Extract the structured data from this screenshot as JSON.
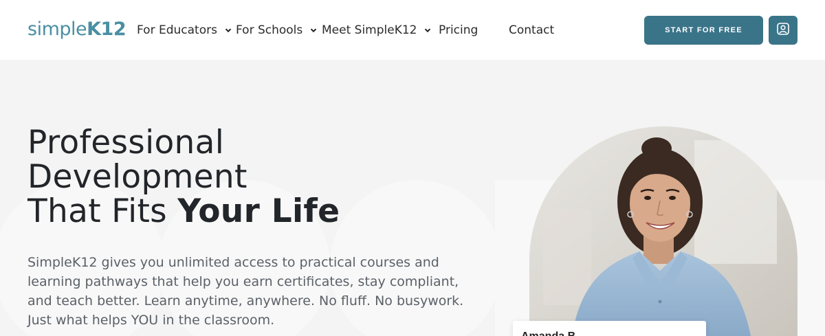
{
  "brand": {
    "logo_simple": "simple",
    "logo_k12": "K12",
    "accent_color": "#3a7489",
    "logo_color": "#4a8fa3"
  },
  "nav": {
    "items": [
      {
        "label": "For Educators",
        "dropdown": true
      },
      {
        "label": "For Schools",
        "dropdown": true
      },
      {
        "label": "Meet SimpleK12",
        "dropdown": true
      },
      {
        "label": "Pricing",
        "dropdown": false
      },
      {
        "label": "Contact",
        "dropdown": false
      }
    ],
    "cta_label": "START FOR FREE",
    "account_icon": "user-account-icon"
  },
  "hero": {
    "headline_line1": "Professional",
    "headline_line2": "Development",
    "headline_line3_regular": "That Fits ",
    "headline_line3_bold": "Your Life",
    "intro": "SimpleK12 gives you unlimited access to practical courses and learning pathways that help you earn certificates, stay compliant, and teach better. Learn anytime, anywhere. No fluff. No busywork. Just what helps YOU in the classroom.",
    "card_name": "Amanda B..."
  }
}
